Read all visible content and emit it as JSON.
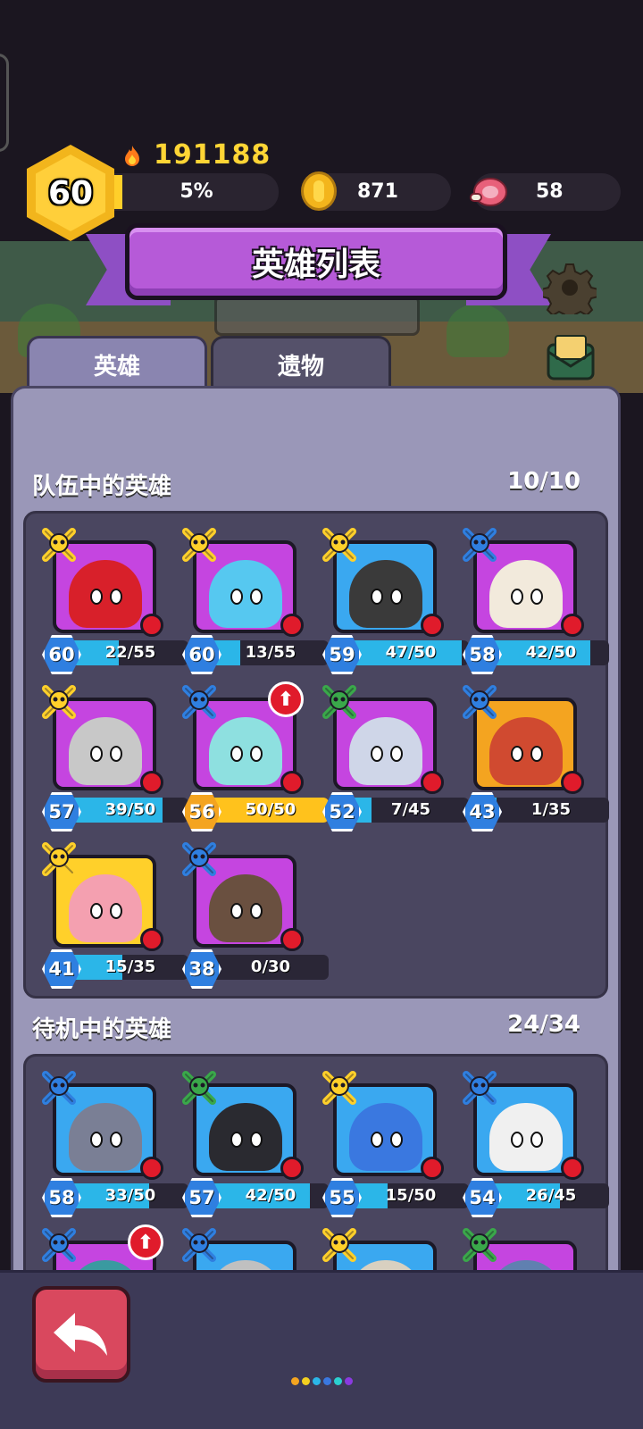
{
  "player": {
    "level": "60",
    "power": "191188",
    "xp_percent_text": "5%",
    "xp_fraction": 0.05
  },
  "resources": {
    "coins": "871",
    "meat": "58"
  },
  "title": "英雄列表",
  "tabs": [
    {
      "label": "英雄",
      "active": true
    },
    {
      "label": "遗物",
      "active": false
    }
  ],
  "sections": {
    "team": {
      "title": "队伍中的英雄",
      "count": "10/10"
    },
    "standby": {
      "title": "待机中的英雄",
      "count": "24/34"
    }
  },
  "team_heroes": [
    {
      "level": "60",
      "shards": "22/55",
      "fill": 0.4,
      "bg": "purple",
      "badge": "yellow-skull",
      "color": "#d8202a"
    },
    {
      "level": "60",
      "shards": "13/55",
      "fill": 0.24,
      "bg": "purple",
      "badge": "yellow-skull",
      "color": "#56c8f0"
    },
    {
      "level": "59",
      "shards": "47/50",
      "fill": 0.94,
      "bg": "blue",
      "badge": "yellow-skull",
      "color": "#3a3a3a"
    },
    {
      "level": "58",
      "shards": "42/50",
      "fill": 0.84,
      "bg": "purple",
      "badge": "blue-skull",
      "color": "#f2eadc"
    },
    {
      "level": "57",
      "shards": "39/50",
      "fill": 0.78,
      "bg": "purple",
      "badge": "yellow-skull",
      "color": "#c8c8c8"
    },
    {
      "level": "56",
      "shards": "50/50",
      "fill": 1.0,
      "bg": "purple",
      "badge": "blue-skull",
      "color": "#8ee0e0",
      "upgrade": true,
      "gold": true
    },
    {
      "level": "52",
      "shards": "7/45",
      "fill": 0.16,
      "bg": "purple",
      "badge": "green-skull",
      "color": "#cfd6e8"
    },
    {
      "level": "43",
      "shards": "1/35",
      "fill": 0.03,
      "bg": "orange",
      "badge": "blue-skull",
      "color": "#d04a30"
    },
    {
      "level": "41",
      "shards": "15/35",
      "fill": 0.43,
      "bg": "yellow",
      "badge": "yellow-skull",
      "color": "#f4a0b0"
    },
    {
      "level": "38",
      "shards": "0/30",
      "fill": 0.0,
      "bg": "purple",
      "badge": "blue-skull",
      "color": "#6a5040"
    }
  ],
  "standby_heroes": [
    {
      "level": "58",
      "shards": "33/50",
      "fill": 0.66,
      "bg": "blue",
      "badge": "blue-skull",
      "color": "#7a7f95"
    },
    {
      "level": "57",
      "shards": "42/50",
      "fill": 0.84,
      "bg": "blue",
      "badge": "green-skull",
      "color": "#2a2a30"
    },
    {
      "level": "55",
      "shards": "15/50",
      "fill": 0.3,
      "bg": "blue",
      "badge": "yellow-skull",
      "color": "#3a78e0"
    },
    {
      "level": "54",
      "shards": "26/45",
      "fill": 0.58,
      "bg": "blue",
      "badge": "blue-skull",
      "color": "#f0f0f0"
    },
    {
      "level": "",
      "shards": "",
      "fill": 0,
      "bg": "purple",
      "badge": "blue-skull",
      "color": "#3a9aa0",
      "upgrade": true
    },
    {
      "level": "",
      "shards": "",
      "fill": 0,
      "bg": "blue",
      "badge": "blue-skull",
      "color": "#c0c0c0"
    },
    {
      "level": "",
      "shards": "",
      "fill": 0,
      "bg": "blue",
      "badge": "yellow-skull",
      "color": "#d8d0c0"
    },
    {
      "level": "",
      "shards": "",
      "fill": 0,
      "bg": "purple",
      "badge": "green-skull",
      "color": "#6080b0"
    }
  ],
  "page_dots": [
    "#f4a420",
    "#f4d020",
    "#2bb6e8",
    "#3a78e0",
    "#2bd0d0",
    "#8a3ae0"
  ]
}
